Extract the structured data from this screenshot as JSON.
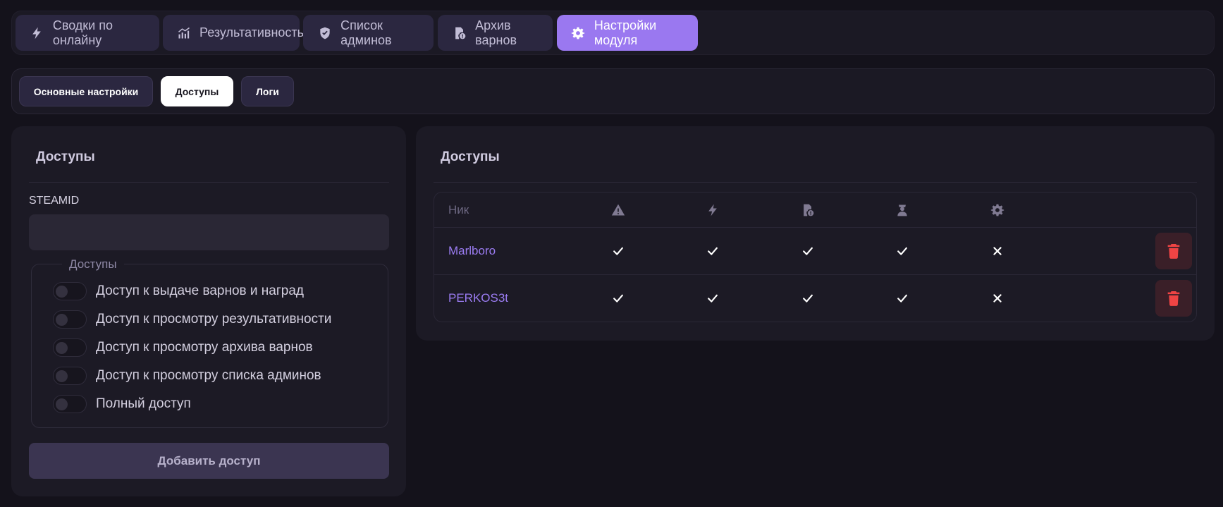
{
  "nav": {
    "tabs": [
      {
        "label": "Сводки по онлайну",
        "icon": "bolt-icon"
      },
      {
        "label": "Результативность",
        "icon": "chart-icon"
      },
      {
        "label": "Список админов",
        "icon": "shield-icon"
      },
      {
        "label": "Архив варнов",
        "icon": "archive-icon"
      },
      {
        "label": "Настройки модуля",
        "icon": "gear-icon",
        "active": true
      }
    ]
  },
  "subnav": {
    "tabs": [
      {
        "label": "Основные настройки"
      },
      {
        "label": "Доступы",
        "active": true
      },
      {
        "label": "Логи"
      }
    ]
  },
  "form": {
    "title": "Доступы",
    "steamid_label": "STEAMID",
    "steamid_value": "",
    "fieldset_legend": "Доступы",
    "permissions": [
      {
        "label": "Доступ к выдаче варнов и наград",
        "enabled": false
      },
      {
        "label": "Доступ к просмотру результативности",
        "enabled": false
      },
      {
        "label": "Доступ к просмотру архива варнов",
        "enabled": false
      },
      {
        "label": "Доступ к просмотру списка админов",
        "enabled": false
      },
      {
        "label": "Полный доступ",
        "enabled": false
      }
    ],
    "submit_label": "Добавить доступ"
  },
  "access_list": {
    "title": "Доступы",
    "columns": {
      "nick": "Ник",
      "icons": [
        "warning-icon",
        "bolt-icon",
        "archive-icon",
        "admin-icon",
        "gear-icon"
      ]
    },
    "rows": [
      {
        "nick": "Marlboro",
        "perms": [
          true,
          true,
          true,
          true,
          false
        ]
      },
      {
        "nick": "PERKOS3t",
        "perms": [
          true,
          true,
          true,
          true,
          false
        ]
      }
    ]
  },
  "colors": {
    "accent": "#9a78f0",
    "background": "#14121b",
    "panel": "#1c1a25",
    "danger": "#ef4444"
  }
}
